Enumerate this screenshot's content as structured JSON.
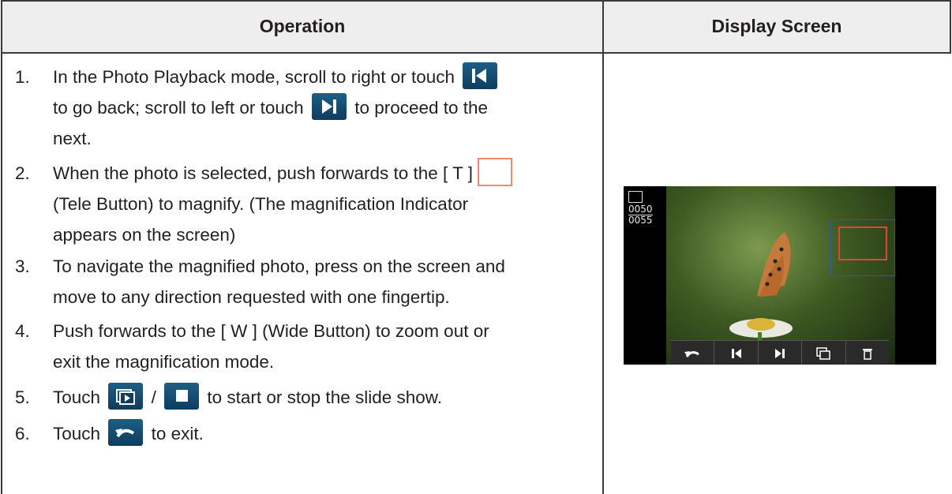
{
  "header": {
    "operation": "Operation",
    "display_screen": "Display Screen"
  },
  "steps": [
    {
      "num": "1.",
      "line1a": "In the Photo Playback mode, scroll to right or touch",
      "line2a": "to go back; scroll to left or touch",
      "line2b": "to proceed to the",
      "line3": "next."
    },
    {
      "num": "2.",
      "line1": "When the photo is selected, push forwards to the [ T ]",
      "line2": "(Tele Button) to magnify. (The magnification Indicator",
      "line3": "appears on the screen)"
    },
    {
      "num": "3.",
      "line1": "To navigate the magnified photo, press on the screen and",
      "line2": "move to any direction requested with one fingertip."
    },
    {
      "num": "4.",
      "line1": "Push forwards to the [ W ] (Wide Button) to zoom out or",
      "line2": "exit the magnification mode."
    },
    {
      "num": "5.",
      "a": "Touch",
      "sep": "/",
      "b": "to start or stop the slide show."
    },
    {
      "num": "6.",
      "a": "Touch",
      "b": "to exit."
    }
  ],
  "screen": {
    "counter_current": "0050",
    "counter_total": "0055"
  },
  "icons": {
    "previous": "skip-previous-icon",
    "next": "skip-next-icon",
    "slideshow": "slideshow-icon",
    "stop": "stop-icon",
    "return": "return-icon",
    "delete": "trash-icon"
  },
  "colors": {
    "icon_blue": "#0f3d5e",
    "zoom_indicator": "#e2433a",
    "header_bg": "#eeeeee"
  }
}
